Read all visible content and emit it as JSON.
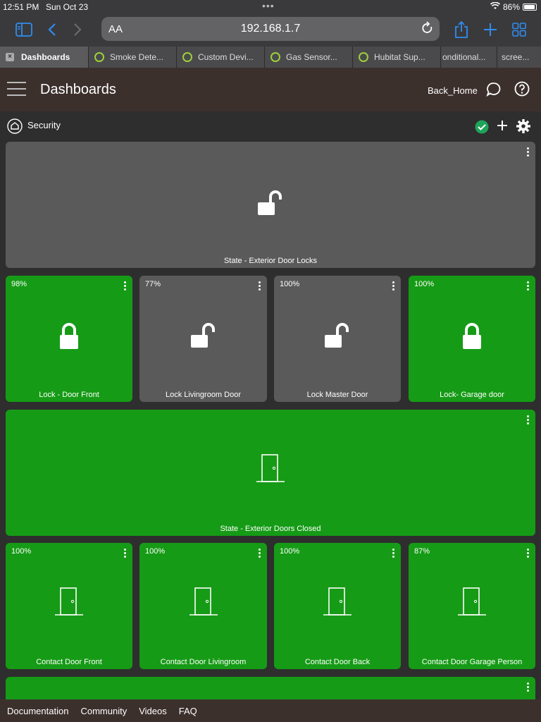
{
  "status": {
    "time": "12:51 PM",
    "date": "Sun Oct 23",
    "battery": "86%"
  },
  "browser": {
    "aa": "AA",
    "url": "192.168.1.7"
  },
  "tabs": [
    {
      "label": "Dashboards",
      "active": true
    },
    {
      "label": "Smoke Dete...",
      "active": false
    },
    {
      "label": "Custom Devi...",
      "active": false
    },
    {
      "label": "Gas Sensor...",
      "active": false
    },
    {
      "label": "Hubitat Sup...",
      "active": false
    },
    {
      "label": "onditional...",
      "active": false
    },
    {
      "label": "scree...",
      "active": false
    }
  ],
  "header": {
    "title": "Dashboards",
    "back_home": "Back_Home"
  },
  "dashboard": {
    "name": "Security"
  },
  "tiles": {
    "state_locks": {
      "label": "State - Exterior Door Locks"
    },
    "lock_front": {
      "pct": "98%",
      "label": "Lock - Door Front"
    },
    "lock_living": {
      "pct": "77%",
      "label": "Lock Livingroom Door"
    },
    "lock_master": {
      "pct": "100%",
      "label": "Lock Master Door"
    },
    "lock_garage": {
      "pct": "100%",
      "label": "Lock- Garage door"
    },
    "state_doors": {
      "label": "State - Exterior Doors Closed"
    },
    "contact_front": {
      "pct": "100%",
      "label": "Contact Door Front"
    },
    "contact_living": {
      "pct": "100%",
      "label": "Contact Door Livingroom"
    },
    "contact_back": {
      "pct": "100%",
      "label": "Contact Door Back"
    },
    "contact_garage": {
      "pct": "87%",
      "label": "Contact Door Garage Person"
    }
  },
  "footer": {
    "documentation": "Documentation",
    "community": "Community",
    "videos": "Videos",
    "faq": "FAQ"
  },
  "colors": {
    "green": "#169b16",
    "gray": "#5a5a5a",
    "header": "#3c302d",
    "accent": "#2f8cf0"
  }
}
